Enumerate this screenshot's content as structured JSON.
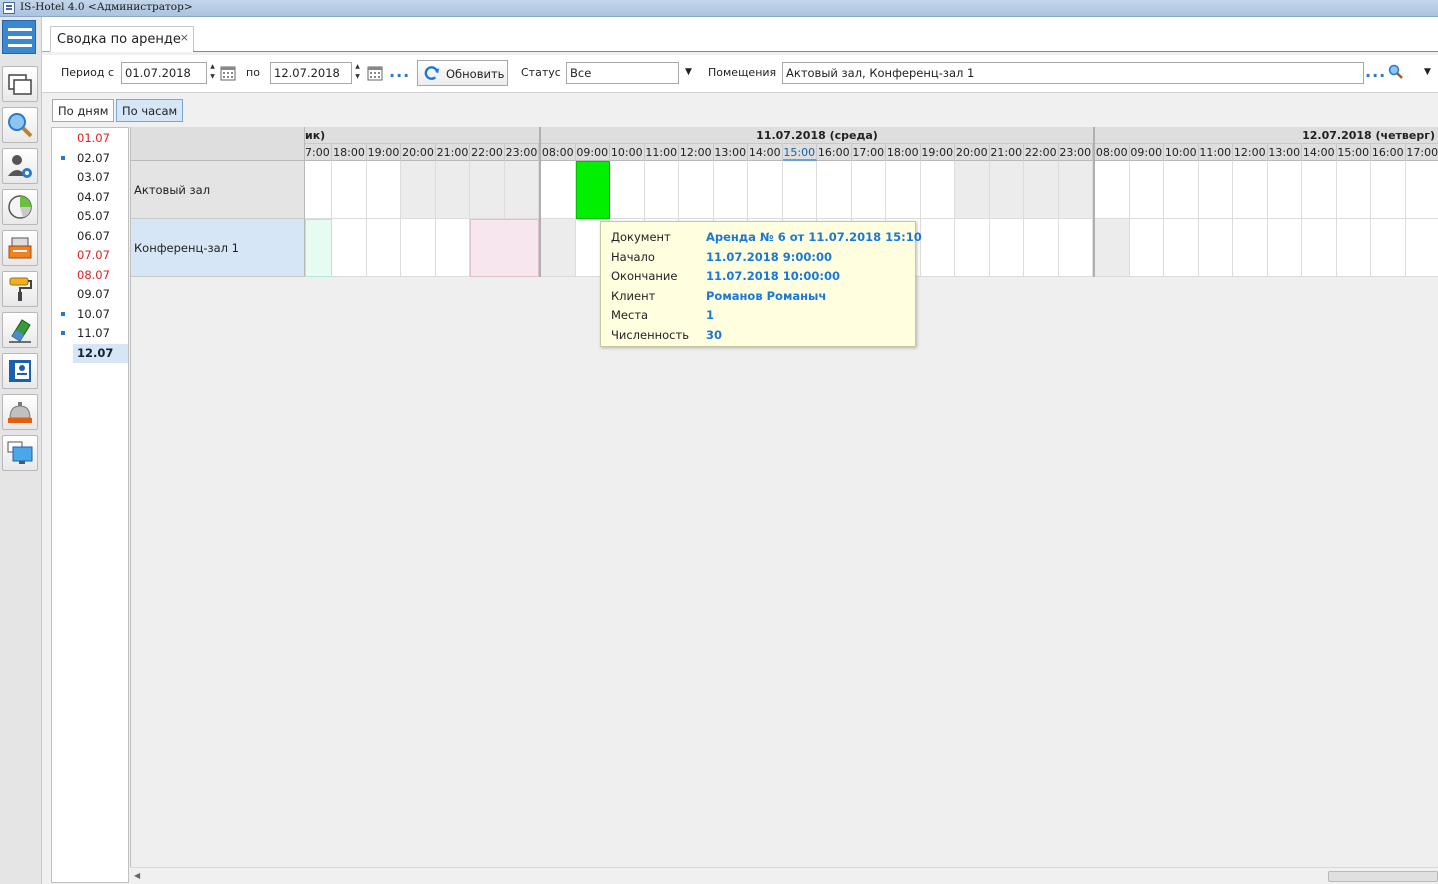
{
  "window": {
    "title": "IS-Hotel 4.0 <Администратор>"
  },
  "tab": {
    "label": "Сводка по аренде",
    "close": "×"
  },
  "filters": {
    "period_from_label": "Период с",
    "period_from_value": "01.07.2018",
    "period_to_label": "по",
    "period_to_value": "12.07.2018",
    "more_dots": "...",
    "refresh_label": "Обновить",
    "status_label": "Статус",
    "status_value": "Все",
    "rooms_label": "Помещения",
    "rooms_value": "Актовый зал, Конференц-зал 1",
    "rooms_dots": "..."
  },
  "views": {
    "by_days": "По дням",
    "by_hours": "По часам"
  },
  "dates": [
    {
      "label": "01.07",
      "red": true,
      "mark": false,
      "selected": false
    },
    {
      "label": "02.07",
      "red": false,
      "mark": true,
      "selected": false
    },
    {
      "label": "03.07",
      "red": false,
      "mark": false,
      "selected": false
    },
    {
      "label": "04.07",
      "red": false,
      "mark": false,
      "selected": false
    },
    {
      "label": "05.07",
      "red": false,
      "mark": false,
      "selected": false
    },
    {
      "label": "06.07",
      "red": false,
      "mark": false,
      "selected": false
    },
    {
      "label": "07.07",
      "red": true,
      "mark": false,
      "selected": false
    },
    {
      "label": "08.07",
      "red": true,
      "mark": false,
      "selected": false
    },
    {
      "label": "09.07",
      "red": false,
      "mark": false,
      "selected": false
    },
    {
      "label": "10.07",
      "red": false,
      "mark": true,
      "selected": false
    },
    {
      "label": "11.07",
      "red": false,
      "mark": true,
      "selected": false
    },
    {
      "label": "12.07",
      "red": false,
      "mark": false,
      "selected": true
    }
  ],
  "schedule": {
    "days": [
      {
        "label": "ик)"
      },
      {
        "label": "11.07.2018  (среда)"
      },
      {
        "label": "12.07.2018  (четверг)"
      }
    ],
    "hours_day1": [
      "7:00",
      "18:00",
      "19:00",
      "20:00",
      "21:00",
      "22:00",
      "23:00"
    ],
    "hours_day2": [
      "08:00",
      "09:00",
      "10:00",
      "11:00",
      "12:00",
      "13:00",
      "14:00",
      "15:00",
      "16:00",
      "17:00",
      "18:00",
      "19:00",
      "20:00",
      "21:00",
      "22:00",
      "23:00"
    ],
    "hours_day3": [
      "08:00",
      "09:00",
      "10:00",
      "11:00",
      "12:00",
      "13:00",
      "14:00",
      "15:00",
      "16:00",
      "17:00"
    ],
    "highlight_hour": "15:00",
    "rooms": [
      "Актовый зал",
      "Конференц-зал 1"
    ]
  },
  "tooltip": {
    "rows": [
      {
        "key": "Документ",
        "value": "Аренда № 6 от 11.07.2018 15:10"
      },
      {
        "key": "Начало",
        "value": "11.07.2018 9:00:00"
      },
      {
        "key": "Окончание",
        "value": "11.07.2018 10:00:00"
      },
      {
        "key": "Клиент",
        "value": "Романов Романыч"
      },
      {
        "key": "Места",
        "value": "1"
      },
      {
        "key": "Численность",
        "value": "30"
      }
    ]
  },
  "colors": {
    "accent": "#2a78c8",
    "booking_green": "#00f000",
    "weekend_red": "#e02020",
    "tooltip_bg": "#ffffe0"
  },
  "icons": [
    "menu-icon",
    "windows-icon",
    "search-icon",
    "user-settings-icon",
    "chart-clock-icon",
    "cash-register-icon",
    "paint-roller-icon",
    "eraser-icon",
    "contacts-book-icon",
    "reception-bell-icon",
    "monitor-icon",
    "calendar-icon",
    "refresh-icon",
    "magnifier-icon"
  ]
}
